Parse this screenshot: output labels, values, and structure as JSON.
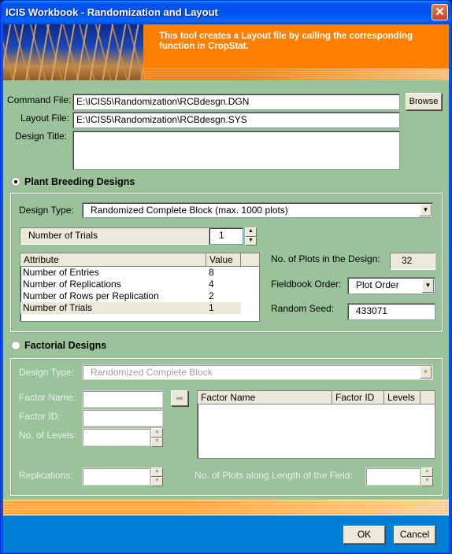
{
  "window": {
    "title": "ICIS Workbook - Randomization and Layout",
    "close_icon": "close-icon"
  },
  "banner": {
    "text": "This tool creates a Layout file by calling the corresponding function in CropStat."
  },
  "files": {
    "command_file_label": "Command File:",
    "command_file_value": "E:\\ICIS5\\Randomization\\RCBdesgn.DGN",
    "browse_label": "Browse",
    "layout_file_label": "Layout File:",
    "layout_file_value": "E:\\ICIS5\\Randomization\\RCBdesgn.SYS",
    "design_title_label": "Design Title:",
    "design_title_value": ""
  },
  "plant_breeding": {
    "radio_label": "Plant Breeding Designs",
    "selected": true,
    "design_type_label": "Design Type:",
    "design_type_value": "Randomized Complete Block (max. 1000 plots)",
    "param_label": "Number of Trials",
    "param_value": "1",
    "table": {
      "headers": [
        "Attribute",
        "Value"
      ],
      "rows": [
        {
          "attribute": "Number of Entries",
          "value": "8"
        },
        {
          "attribute": "Number of Replications",
          "value": "4"
        },
        {
          "attribute": "Number of Rows per Replication",
          "value": "2"
        },
        {
          "attribute": "Number of Trials",
          "value": "1"
        }
      ]
    },
    "plots_label": "No. of Plots in the Design:",
    "plots_value": "32",
    "fieldbook_label": "Fieldbook Order:",
    "fieldbook_value": "Plot Order",
    "seed_label": "Random Seed:",
    "seed_value": "433071"
  },
  "factorial": {
    "radio_label": "Factorial Designs",
    "selected": false,
    "design_type_label": "Design Type:",
    "design_type_value": "Randomized Complete Block",
    "factor_name_label": "Factor Name:",
    "factor_id_label": "Factor ID:",
    "levels_label": "No. of Levels:",
    "replications_label": "Replications:",
    "table_headers": [
      "Factor Name",
      "Factor ID",
      "Levels"
    ],
    "plots_length_label": "No. of Plots along Length of the Field:"
  },
  "footer": {
    "ok_label": "OK",
    "cancel_label": "Cancel"
  }
}
